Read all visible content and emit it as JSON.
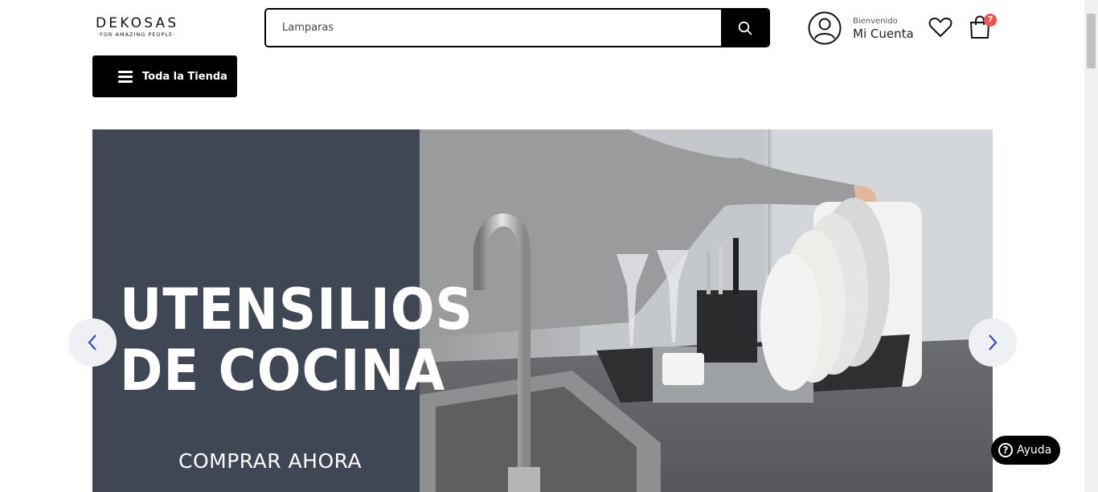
{
  "header": {
    "logo_text": "DEKOSAS",
    "logo_tagline": "FOR AMAZING PEOPLE",
    "search": {
      "value": "Lamparas",
      "placeholder": ""
    },
    "account": {
      "greeting": "Bienvenido",
      "label": "Mi Cuenta"
    },
    "cart_count": "7"
  },
  "nav": {
    "store_label": "Toda la Tienda"
  },
  "banner": {
    "title_line1": "UTENSILIOS",
    "title_line2": "DE COCINA",
    "cta": "COMPRAR AHORA"
  },
  "help": {
    "label": "Ayuda",
    "icon_glyph": "?"
  },
  "colors": {
    "accent": "#000000",
    "banner_panel": "#3f4654",
    "badge": "#ef5350",
    "arrow_icon": "#2f4bd1"
  },
  "icons": [
    "search-icon",
    "user-icon",
    "heart-icon",
    "bag-icon",
    "menu-icon",
    "chevron-left-icon",
    "chevron-right-icon",
    "help-icon"
  ]
}
